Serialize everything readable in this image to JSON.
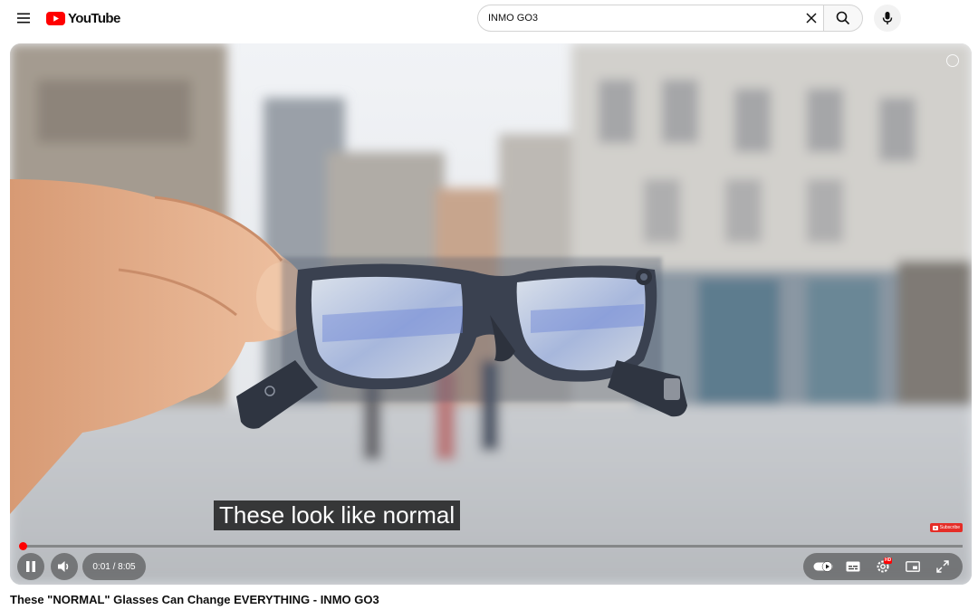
{
  "header": {
    "logo_text": "YouTube",
    "search": {
      "value": "INMO GO3",
      "placeholder": "Search"
    }
  },
  "player": {
    "caption": "These look like normal",
    "time": "0:01 / 8:05",
    "progress": 0.002,
    "watermark_label": "Subscribe",
    "quality_badge": "HD"
  },
  "video": {
    "title": "These \"NORMAL\" Glasses Can Change EVERYTHING - INMO GO3"
  },
  "colors": {
    "brand_red": "#ff0000",
    "text_primary": "#0f0f0f"
  },
  "icons": [
    "menu-icon",
    "youtube-logo-icon",
    "close-icon",
    "search-icon",
    "mic-icon",
    "pause-icon",
    "volume-icon",
    "autoplay-toggle-icon",
    "subtitles-icon",
    "settings-icon",
    "miniplayer-icon",
    "fullscreen-icon"
  ]
}
